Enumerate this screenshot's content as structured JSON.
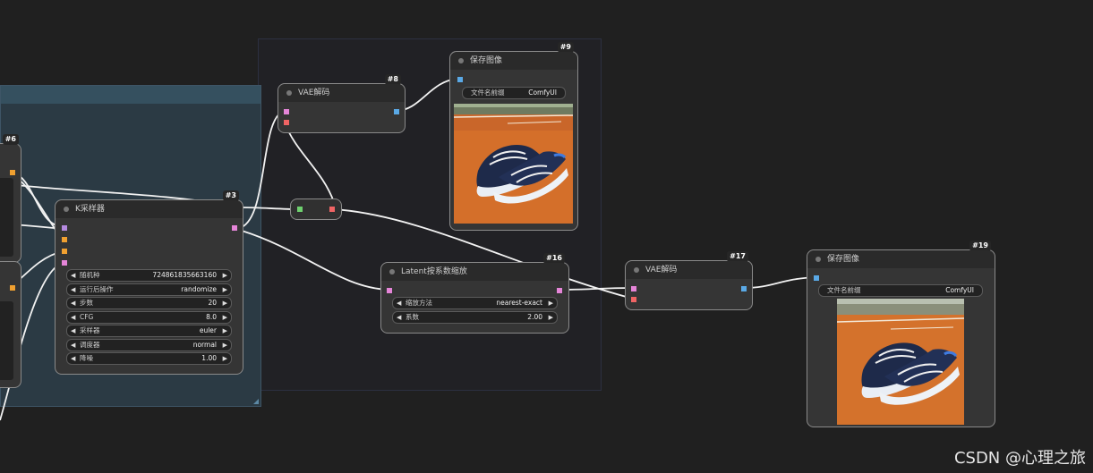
{
  "nodes": {
    "vae_decode_8": {
      "id": "#8",
      "title": "VAE解码"
    },
    "save_image_9": {
      "id": "#9",
      "title": "保存图像",
      "filename_label": "文件名前缀",
      "filename_value": "ComfyUI"
    },
    "ksampler_3": {
      "id": "#3",
      "title": "K采样器",
      "widgets": [
        {
          "label": "随机种",
          "value": "724861835663160"
        },
        {
          "label": "运行后操作",
          "value": "randomize"
        },
        {
          "label": "步数",
          "value": "20"
        },
        {
          "label": "CFG",
          "value": "8.0"
        },
        {
          "label": "采样器",
          "value": "euler"
        },
        {
          "label": "调度器",
          "value": "normal"
        },
        {
          "label": "降噪",
          "value": "1.00"
        }
      ]
    },
    "latent_upscale_16": {
      "id": "#16",
      "title": "Latent按系数缩放",
      "widgets": [
        {
          "label": "缩放方法",
          "value": "nearest-exact"
        },
        {
          "label": "系数",
          "value": "2.00"
        }
      ]
    },
    "vae_decode_17": {
      "id": "#17",
      "title": "VAE解码"
    },
    "save_image_19": {
      "id": "#19",
      "title": "保存图像",
      "filename_label": "文件名前缀",
      "filename_value": "ComfyUI"
    },
    "clip_node_6": {
      "id": "#6"
    }
  },
  "watermark": "CSDN @心理之旅",
  "colors": {
    "background": "#202020",
    "group_blue": "#2b3a44",
    "port_latent": "#e585d8",
    "port_vae": "#f06464",
    "port_image": "#5aa9e6",
    "port_conditioning": "#f0a030",
    "port_model": "#b58ae0"
  }
}
